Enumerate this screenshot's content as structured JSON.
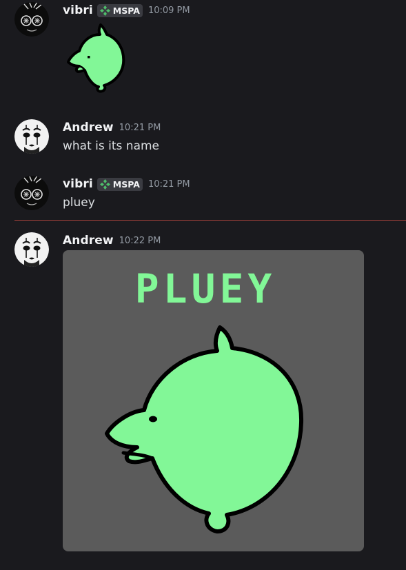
{
  "messages": [
    {
      "username": "vibri",
      "tag": "MSPA",
      "timestamp": "10:09 PM",
      "avatar_icon": "spiky-face-avatar-icon",
      "sticker": "green-blob-creature"
    },
    {
      "username": "Andrew",
      "timestamp": "10:21 PM",
      "avatar_icon": "mime-face-avatar-icon",
      "text": "what is its name"
    },
    {
      "username": "vibri",
      "tag": "MSPA",
      "timestamp": "10:21 PM",
      "avatar_icon": "spiky-face-avatar-icon",
      "text": "pluey"
    },
    {
      "username": "Andrew",
      "timestamp": "10:22 PM",
      "avatar_icon": "mime-face-avatar-icon",
      "attachment": {
        "caption_text": "PLUEY",
        "background": "#5b5b5b",
        "creature_color": "#82f797"
      }
    }
  ],
  "colors": {
    "background": "#1a1a1e",
    "unread_divider": "#a5423b",
    "tag_background": "#3a3b41",
    "tag_icon": "#4fbf6b"
  }
}
